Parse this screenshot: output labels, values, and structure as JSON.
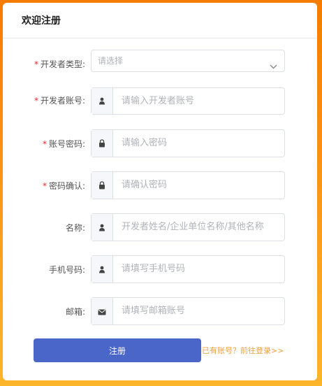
{
  "header": {
    "title": "欢迎注册"
  },
  "form": {
    "developer_type": {
      "label": "开发者类型:",
      "placeholder": "请选择",
      "required": true
    },
    "developer_account": {
      "label": "开发者账号:",
      "placeholder": "请输入开发者账号",
      "required": true
    },
    "password": {
      "label": "账号密码:",
      "placeholder": "请输入密码",
      "required": true
    },
    "confirm_password": {
      "label": "密码确认:",
      "placeholder": "请确认密码",
      "required": true
    },
    "name": {
      "label": "名称:",
      "placeholder": "开发者姓名/企业单位名称/其他名称",
      "required": false
    },
    "phone": {
      "label": "手机号码:",
      "placeholder": "请填写手机号码",
      "required": false
    },
    "email": {
      "label": "邮箱:",
      "placeholder": "请填写邮箱账号",
      "required": false
    },
    "required_mark": "*"
  },
  "actions": {
    "register_label": "注册",
    "login_link": "已有账号？前往登录>>"
  },
  "colors": {
    "primary": "#4a66c9",
    "required": "#f5222d",
    "link": "#f0a13a",
    "background_top": "#f57c00"
  },
  "icons": {
    "user": "user-icon",
    "lock": "lock-icon",
    "mail": "mail-icon",
    "chevron": "chevron-down-icon"
  }
}
